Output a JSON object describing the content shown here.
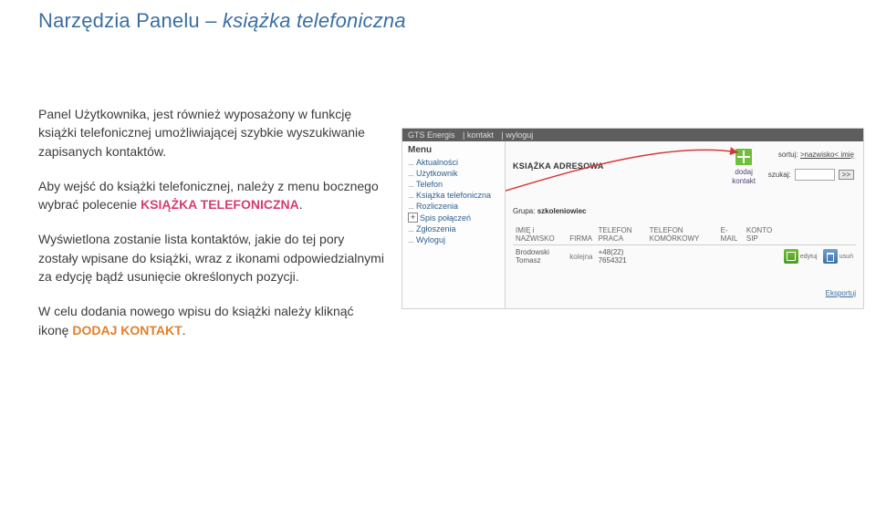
{
  "title": {
    "main": "Narzędzia Panelu – ",
    "italic": "książka telefoniczna"
  },
  "paragraphs": {
    "p1": "Panel Użytkownika, jest również wyposażony w funkcję książki telefonicznej umożliwiającej szybkie wyszukiwanie zapisanych kontaktów.",
    "p2a": "Aby wejść do książki telefonicznej, należy z menu bocznego wybrać polecenie ",
    "p2hl": "KSIĄŻKA TELEFONICZNA",
    "p2b": ".",
    "p3": "Wyświetlona zostanie lista kontaktów, jakie do tej pory zostały wpisane do książki, wraz z ikonami odpowiedzialnymi za edycję bądź usunięcie określonych pozycji.",
    "p4a": "W celu dodania nowego wpisu do książki należy kliknąć ikonę ",
    "p4hl": "DODAJ KONTAKT",
    "p4b": "."
  },
  "screenshot": {
    "topbar": {
      "a": "GTS Energis",
      "b": "kontakt",
      "c": "wyloguj"
    },
    "menu": {
      "title": "Menu",
      "items": [
        "Aktualności",
        "Użytkownik",
        "Telefon",
        "Książka telefoniczna",
        "Rozliczenia",
        "Spis połączeń",
        "Zgłoszenia",
        "Wyloguj"
      ]
    },
    "heading": "KSIĄŻKA ADRESOWA",
    "group_label": "Grupa:",
    "group_value": "szkoleniowiec",
    "sort": {
      "label": "sortuj:",
      "value": ">nazwisko< imię"
    },
    "search": {
      "label": "szukaj:",
      "button": ">>"
    },
    "add": {
      "line1": "dodaj",
      "line2": "kontakt"
    },
    "table": {
      "headers": [
        "IMIĘ i NAZWISKO",
        "FIRMA",
        "TELEFON PRACA",
        "TELEFON KOMÓRKOWY",
        "E-MAIL",
        "KONTO SIP"
      ],
      "row": {
        "name": "Brodowski Tomasz",
        "firma": "",
        "tel1": "+48(22) 7654321",
        "tel2": "",
        "email": "",
        "sip": ""
      },
      "kolejna": "kolejna",
      "edit": "edytuj",
      "del": "usuń"
    },
    "export": "Eksportuj"
  }
}
